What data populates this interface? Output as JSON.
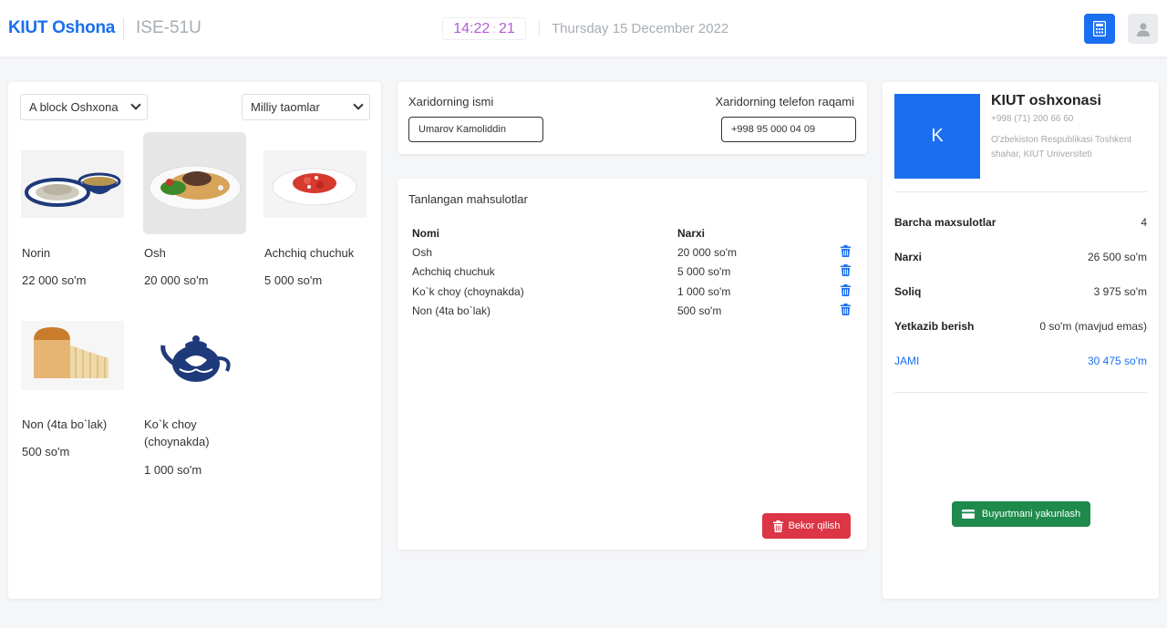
{
  "header": {
    "brand": "KIUT Oshona",
    "station": "ISE-51U",
    "clock": {
      "hm": "14:22",
      "sep": ":",
      "sec": "21"
    },
    "date": "Thursday 15 December 2022"
  },
  "filters": {
    "location": "A block Oshxona",
    "category": "Milliy taomlar"
  },
  "products": [
    {
      "name": "Norin",
      "price": "22 000 so'm",
      "icon": "norin-dish-image"
    },
    {
      "name": "Osh",
      "price": "20 000 so'm",
      "icon": "osh-plate-image",
      "selected": true
    },
    {
      "name": "Achchiq chuchuk",
      "price": "5 000 so'm",
      "icon": "salad-plate-image"
    },
    {
      "name": "Non (4ta bo`lak)",
      "price": "500 so'm",
      "icon": "bread-loaf-image"
    },
    {
      "name": "Ko`k choy (choynakda)",
      "price": "1 000 so'm",
      "icon": "teapot-image"
    }
  ],
  "customer": {
    "name_label": "Xaridorning ismi",
    "name_value": "Umarov Kamoliddin",
    "phone_label": "Xaridorning telefon raqami",
    "phone_value": "+998 95 000 04 09"
  },
  "selected": {
    "title": "Tanlangan mahsulotlar",
    "col_name": "Nomi",
    "col_price": "Narxi",
    "rows": [
      {
        "name": "Osh",
        "price": "20 000 so'm"
      },
      {
        "name": "Achchiq chuchuk",
        "price": "5 000 so'm"
      },
      {
        "name": "Ko`k choy (choynakda)",
        "price": "1 000 so'm"
      },
      {
        "name": "Non (4ta bo`lak)",
        "price": "500 so'm"
      }
    ],
    "cancel_label": "Bekor qilish"
  },
  "store": {
    "initial": "K",
    "name": "KIUT oshxonasi",
    "phone": "+998 (71) 200 66 60",
    "address": "O'zbekiston Respublikasi Toshkent shahar, KIUT Universiteti"
  },
  "summary": {
    "count_label": "Barcha maxsulotlar",
    "count_value": "4",
    "price_label": "Narxi",
    "price_value": "26 500 so'm",
    "tax_label": "Soliq",
    "tax_value": "3 975 so'm",
    "delivery_label": "Yetkazib berish",
    "delivery_value": "0 so'm (mavjud emas)",
    "total_label": "JAMI",
    "total_value": "30 475 so'm",
    "finish_label": "Buyurtmani yakunlash"
  },
  "colors": {
    "primary": "#1a6ff0",
    "danger": "#dc3545",
    "success": "#1e8a4c",
    "clock": "#b45ad8"
  }
}
